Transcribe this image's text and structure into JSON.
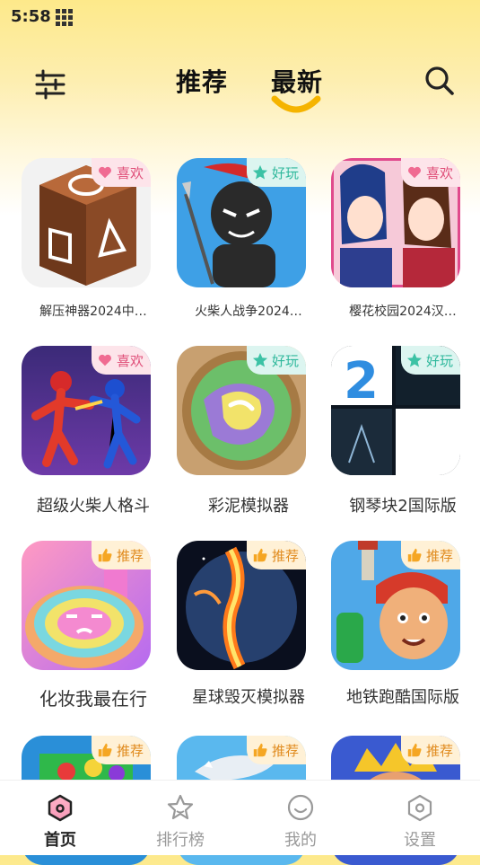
{
  "status": {
    "time": "5:58"
  },
  "header": {
    "tabs": [
      {
        "label": "推荐",
        "active": false
      },
      {
        "label": "最新",
        "active": true
      }
    ]
  },
  "colors": {
    "accent": "#f5b400",
    "tag_like": "#e0507a",
    "tag_fun": "#2fb89c",
    "tag_rec": "#e08a1d"
  },
  "games": [
    {
      "title": "解压神器2024中…",
      "tag": "喜欢",
      "tag_icon": "heart-icon"
    },
    {
      "title": "火柴人战争2024…",
      "tag": "好玩",
      "tag_icon": "star-icon"
    },
    {
      "title": "樱花校园2024汉…",
      "tag": "喜欢",
      "tag_icon": "heart-icon"
    },
    {
      "title": "超级火柴人格斗",
      "tag": "喜欢",
      "tag_icon": "heart-icon"
    },
    {
      "title": "彩泥模拟器",
      "tag": "好玩",
      "tag_icon": "star-icon"
    },
    {
      "title": "钢琴块2国际版",
      "tag": "好玩",
      "tag_icon": "star-icon"
    },
    {
      "title": "化妆我最在行",
      "tag": "推荐",
      "tag_icon": "thumbs-up-icon"
    },
    {
      "title": "星球毁灭模拟器",
      "tag": "推荐",
      "tag_icon": "thumbs-up-icon"
    },
    {
      "title": "地铁跑酷国际版",
      "tag": "推荐",
      "tag_icon": "thumbs-up-icon"
    },
    {
      "title": "",
      "tag": "推荐",
      "tag_icon": "thumbs-up-icon"
    },
    {
      "title": "",
      "tag": "推荐",
      "tag_icon": "thumbs-up-icon"
    },
    {
      "title": "",
      "tag": "推荐",
      "tag_icon": "thumbs-up-icon"
    }
  ],
  "bottom_nav": [
    {
      "label": "首页",
      "icon": "home-icon",
      "active": true
    },
    {
      "label": "排行榜",
      "icon": "star-icon",
      "active": false
    },
    {
      "label": "我的",
      "icon": "smile-icon",
      "active": false
    },
    {
      "label": "设置",
      "icon": "settings-icon",
      "active": false
    }
  ]
}
